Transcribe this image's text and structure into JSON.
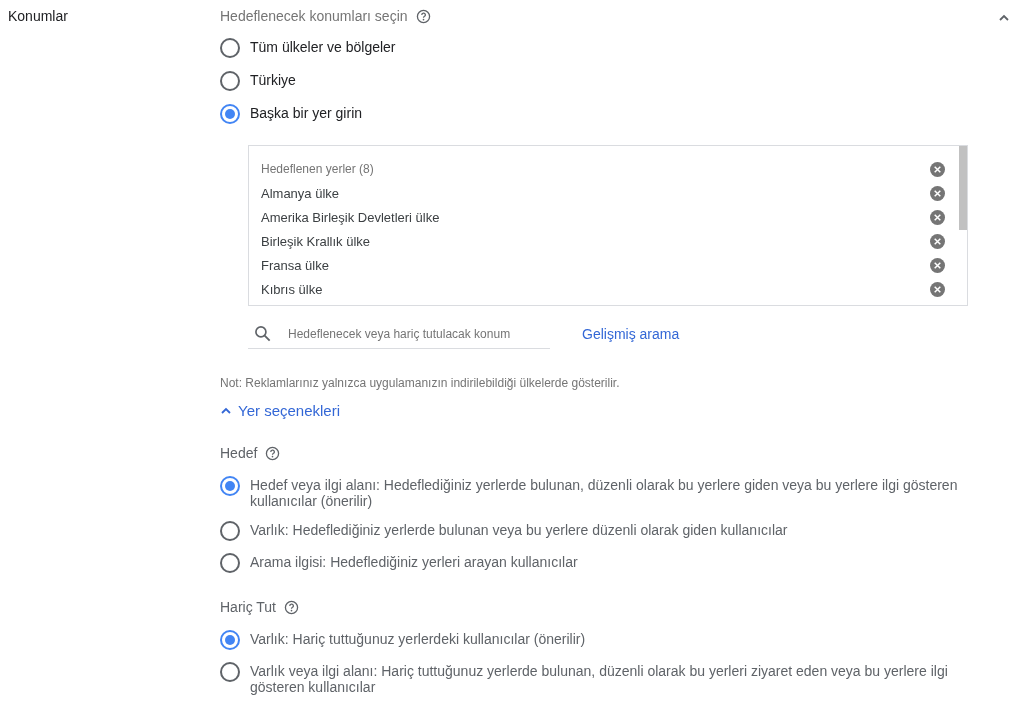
{
  "section_label": "Konumlar",
  "expanded": true,
  "target_heading": "Hedeflenecek konumları seçin",
  "location_options": [
    {
      "label": "Tüm ülkeler ve bölgeler",
      "selected": false
    },
    {
      "label": "Türkiye",
      "selected": false
    },
    {
      "label": "Başka bir yer girin",
      "selected": true
    }
  ],
  "targeted_places": {
    "heading": "Hedeflenen yerler (8)",
    "items": [
      {
        "label": "Almanya ülke"
      },
      {
        "label": "Amerika Birleşik Devletleri ülke"
      },
      {
        "label": "Birleşik Krallık ülke"
      },
      {
        "label": "Fransa ülke"
      },
      {
        "label": "Kıbrıs ülke"
      }
    ]
  },
  "search": {
    "placeholder": "Hedeflenecek veya hariç tutulacak konum"
  },
  "advanced_search_link": "Gelişmiş arama",
  "note": "Not: Reklamlarınız yalnızca uygulamanızın indirilebildiği ülkelerde gösterilir.",
  "place_options_toggle": {
    "label": "Yer seçenekleri",
    "expanded": true
  },
  "groups": [
    {
      "heading": "Hedef",
      "options": [
        {
          "label": "Hedef veya ilgi alanı: Hedeflediğiniz yerlerde bulunan, düzenli olarak bu yerlere giden veya bu yerlere ilgi gösteren kullanıcılar (önerilir)",
          "selected": true
        },
        {
          "label": "Varlık: Hedeflediğiniz yerlerde bulunan veya bu yerlere düzenli olarak giden kullanıcılar",
          "selected": false
        },
        {
          "label": "Arama ilgisi: Hedeflediğiniz yerleri arayan kullanıcılar",
          "selected": false
        }
      ]
    },
    {
      "heading": "Hariç Tut",
      "options": [
        {
          "label": "Varlık: Hariç tuttuğunuz yerlerdeki kullanıcılar (önerilir)",
          "selected": true
        },
        {
          "label": "Varlık veya ilgi alanı: Hariç tuttuğunuz yerlerde bulunan, düzenli olarak bu yerleri ziyaret eden veya bu yerlere ilgi gösteren kullanıcılar",
          "selected": false
        }
      ]
    }
  ]
}
